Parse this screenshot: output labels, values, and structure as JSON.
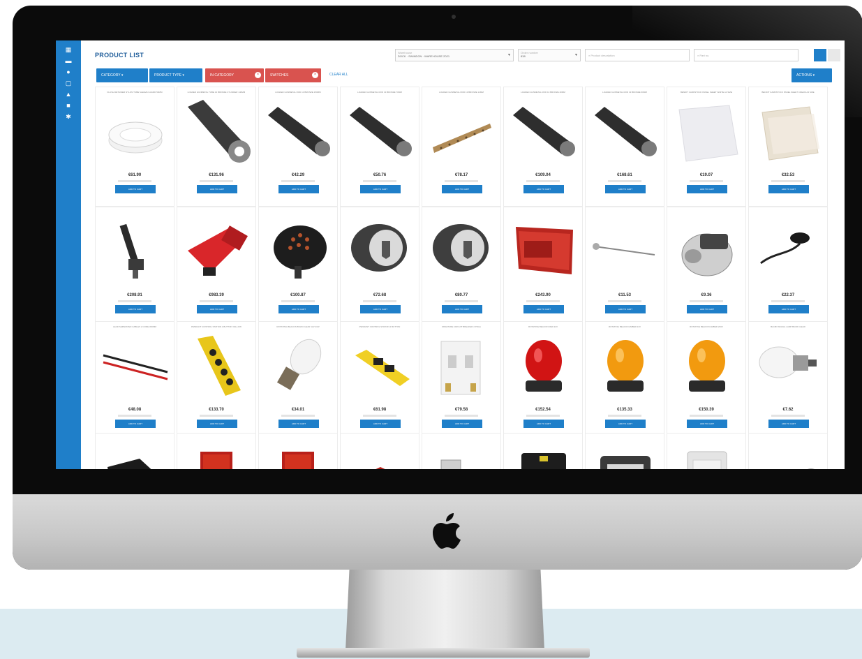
{
  "app": {
    "page_title": "PRODUCT LIST",
    "brand_color": "#1f7fc9",
    "alert_color": "#d9534f"
  },
  "sidebar": {
    "icons": [
      "grid-icon",
      "folder-icon",
      "user-icon",
      "cart-icon",
      "bell-icon",
      "lock-icon",
      "settings-icon"
    ]
  },
  "header": {
    "select_one": {
      "caption": "Warehouse",
      "value": "DOCK · SWINDON · WAREHOUSE 2021"
    },
    "select_two": {
      "caption": "Order number",
      "value": "838"
    },
    "search_one_placeholder": "Product description",
    "search_two_placeholder": "Part no."
  },
  "filters": {
    "category_label": "CATEGORY",
    "product_type_label": "PRODUCT TYPE",
    "active_one_label": "IN CATEGORY",
    "active_two_label": "SWITCHES",
    "reset_label": "CLEAR ALL",
    "actions_label": "ACTIONS"
  },
  "add_label": "ADD TO CART",
  "products": [
    {
      "name": "FLUSH RETAINER NYLON TUBE SLEEVE GUARD 50MM",
      "price": "€61.90",
      "image": "tube-coil"
    },
    {
      "name": "LOADED GUNMETAL TUBE 13 BRONZE CYLINDER 140MM",
      "price": "€131.96",
      "image": "rod-hollow"
    },
    {
      "name": "LOADED GUNMETAL ROD 13 BRONZE 150MM",
      "price": "€42.29",
      "image": "rod-solid"
    },
    {
      "name": "LOADED GUNMETAL ROD 13 BRONZE 70MM",
      "price": "€50.76",
      "image": "rod-solid"
    },
    {
      "name": "LOADED GUNMETAL ROD 13 BRONZE 14MM",
      "price": "€78.17",
      "image": "rod-thin"
    },
    {
      "name": "LOADED GUNMETAL ROD 13 BRONZE 40MM",
      "price": "€109.04",
      "image": "rod-solid"
    },
    {
      "name": "LOADED GUNMETAL ROD 13 BRONZE 60MM",
      "price": "€168.61",
      "image": "rod-solid"
    },
    {
      "name": "BENDIT CARDSTOCK PANEL SHEET WHITE A4 SIZE",
      "price": "€19.07",
      "image": "sheet-white"
    },
    {
      "name": "BENDIT CARDSTOCK PANEL SHEET CREAM A4 SIZE",
      "price": "€32.53",
      "image": "sheet-cream"
    },
    {
      "name": "",
      "price": "€208.91",
      "image": "valve-stem"
    },
    {
      "name": "",
      "price": "€983.39",
      "image": "horn-red"
    },
    {
      "name": "",
      "price": "€100.87",
      "image": "sounder-dark"
    },
    {
      "name": "",
      "price": "€72.68",
      "image": "sounder-grey"
    },
    {
      "name": "",
      "price": "€80.77",
      "image": "sounder-grey"
    },
    {
      "name": "",
      "price": "€243.90",
      "image": "panel-red"
    },
    {
      "name": "",
      "price": "€11.53",
      "image": "probe"
    },
    {
      "name": "",
      "price": "€9.36",
      "image": "pump"
    },
    {
      "name": "",
      "price": "€22.37",
      "image": "sensor"
    },
    {
      "name": "LEAD SEPARATED CABLES 2 CORE 300MM",
      "price": "€48.08",
      "image": "wires"
    },
    {
      "name": "PENDANT CONTROL STATION 4 BUTTON YELLOW",
      "price": "€133.70",
      "image": "pendant-yellow"
    },
    {
      "name": "ROTATING BEACON BULB CLEAR 12V 21W",
      "price": "€34.01",
      "image": "bulb-clear"
    },
    {
      "name": "PENDANT CONTROL STATION 2 BUTTON",
      "price": "€61.98",
      "image": "pendant-small"
    },
    {
      "name": "MINIATURE CIRCUIT BREAKER 2 POLE",
      "price": "€79.58",
      "image": "breaker"
    },
    {
      "name": "ROTATING BEACON RED 24V",
      "price": "€152.54",
      "image": "beacon-red"
    },
    {
      "name": "ROTATING BEACON AMBER 24V",
      "price": "€135.33",
      "image": "beacon-amber"
    },
    {
      "name": "ROTATING BEACON AMBER 230V",
      "price": "€150.39",
      "image": "beacon-amber"
    },
    {
      "name": "BA15D SIGNAL LAMP BULB CLEAR",
      "price": "€7.62",
      "image": "bulb-side"
    },
    {
      "name": "",
      "price": "",
      "image": "speaker-black"
    },
    {
      "name": "",
      "price": "",
      "image": "sounder-red"
    },
    {
      "name": "",
      "price": "",
      "image": "sounder-red"
    },
    {
      "name": "",
      "price": "",
      "image": "double-red"
    },
    {
      "name": "",
      "price": "",
      "image": "pushbutton-green"
    },
    {
      "name": "",
      "price": "",
      "image": "box-black"
    },
    {
      "name": "",
      "price": "",
      "image": "box-grey"
    },
    {
      "name": "",
      "price": "",
      "image": "box-white"
    },
    {
      "name": "",
      "price": "",
      "image": "cable-lamp"
    }
  ]
}
